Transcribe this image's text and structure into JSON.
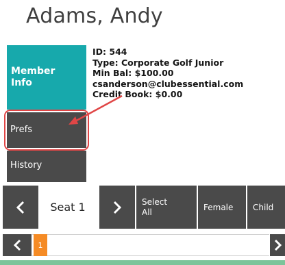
{
  "header": {
    "title": "Adams, Andy"
  },
  "tabs": {
    "member_info": "Member\nInfo",
    "prefs": "Prefs",
    "history": "History"
  },
  "member": {
    "id": "ID: 544",
    "type": "Type: Corporate Golf Junior",
    "min_bal": "Min Bal: $100.00",
    "email": "csanderson@clubessential.com",
    "credit_book": "Credit Book: $0.00"
  },
  "seat_bar": {
    "prev_icon": "chevron-left-icon",
    "seat_label": "Seat 1",
    "next_icon": "chevron-right-icon",
    "select_all": "Select\nAll",
    "female": "Female",
    "child": "Child"
  },
  "scroller": {
    "left_icon": "chevron-left-icon",
    "item_label": "1",
    "right_icon": "chevron-right-icon"
  },
  "colors": {
    "teal": "#17a9ac",
    "dark_tile": "#4a4a4a",
    "highlight_red": "#e04646",
    "orange": "#f58b25",
    "green_strip": "#7cc49a"
  }
}
